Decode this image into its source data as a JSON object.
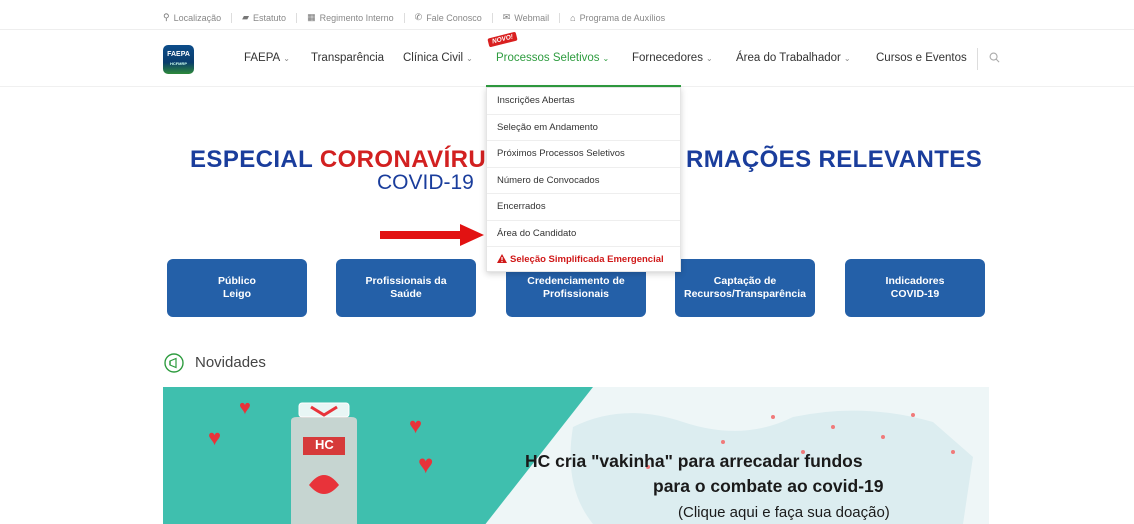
{
  "topbar": {
    "items": [
      {
        "icon": "map-pin-icon",
        "label": "Localização"
      },
      {
        "icon": "book-icon",
        "label": "Estatuto"
      },
      {
        "icon": "grid-icon",
        "label": "Regimento Interno"
      },
      {
        "icon": "phone-icon",
        "label": "Fale Conosco"
      },
      {
        "icon": "mail-icon",
        "label": "Webmail"
      },
      {
        "icon": "institution-icon",
        "label": "Programa de Auxílios"
      }
    ]
  },
  "logo": {
    "text": "FAEPA",
    "sub": "HCFMRP"
  },
  "nav": {
    "items": [
      "FAEPA",
      "Transparência",
      "Clínica Civil",
      "Processos Seletivos",
      "Fornecedores",
      "Área do Trabalhador",
      "Cursos e Eventos"
    ],
    "badge": "NOVO!"
  },
  "dropdown": {
    "items": [
      "Inscrições Abertas",
      "Seleção em Andamento",
      "Próximos Processos Seletivos",
      "Número de Convocados",
      "Encerrados",
      "Área do Candidato"
    ],
    "alert_item": "Seleção Simplificada Emergencial"
  },
  "headline": {
    "part1": "ESPECIAL",
    "part_red": "CORONAVÍRUS",
    "part_fragment": "S",
    "part2": "RMAÇÕES RELEVANTES",
    "sub": "COVID-19"
  },
  "categories": [
    "Público Leigo",
    "Profissionais da Saúde",
    "Credenciamento de Profissionais",
    "Captação de Recursos/Transparência",
    "Indicadores COVID-19"
  ],
  "novidades": {
    "label": "Novidades"
  },
  "banner": {
    "jar_label": "HC",
    "line1": "HC cria \"vakinha\" para arrecadar fundos",
    "line2": "para o combate ao covid-19",
    "line3": "(Clique aqui e faça sua doação)"
  },
  "colors": {
    "accent_green": "#2e9c3f",
    "brand_blue": "#2460a8",
    "alert_red": "#d22020"
  }
}
